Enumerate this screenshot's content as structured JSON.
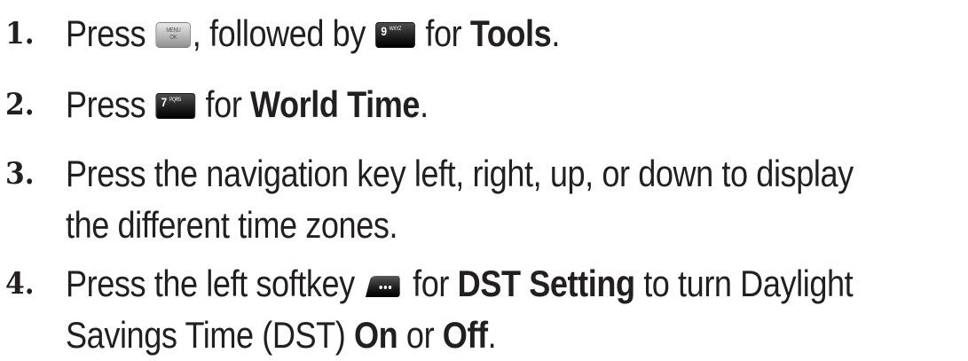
{
  "steps": [
    {
      "number": "1.",
      "press": "Press ",
      "key1": {
        "name": "menu-ok-key",
        "line1": "MENU",
        "line2": "OK"
      },
      "mid": ", followed by ",
      "key2": {
        "name": "9-wxyz-key",
        "big": "9",
        "small": "WXYZ"
      },
      "for": " for ",
      "bold": "Tools",
      "end": "."
    },
    {
      "number": "2.",
      "press": "Press ",
      "key1": {
        "name": "7-pqrs-key",
        "big": "7",
        "small": "PQRS"
      },
      "for": " for ",
      "bold": "World Time",
      "end": "."
    },
    {
      "number": "3.",
      "line1": "Press the navigation key left, right, up, or down to display",
      "line2": "the different time zones."
    },
    {
      "number": "4.",
      "press": "Press the left softkey",
      "for": "for ",
      "bold1": "DST Setting",
      "rest1": " to turn Daylight",
      "line2a": "Savings Time (DST) ",
      "bold2": "On",
      "or": " or ",
      "bold3": "Off",
      "end": "."
    }
  ]
}
